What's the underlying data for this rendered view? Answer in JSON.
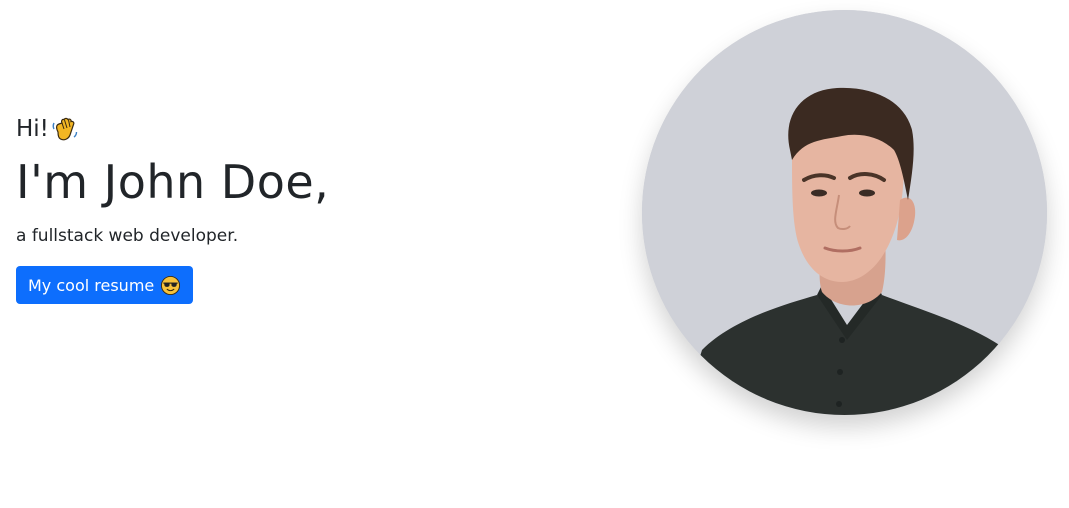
{
  "hero": {
    "greeting": "Hi!",
    "greeting_icon": "waving-hand-icon",
    "name_heading": "I'm John Doe,",
    "tagline": "a fullstack web developer.",
    "resume_button": {
      "label": "My cool resume",
      "icon": "sunglasses-face-icon"
    }
  },
  "colors": {
    "button_bg": "#0d6efd",
    "text": "#212529",
    "background": "#ffffff"
  }
}
